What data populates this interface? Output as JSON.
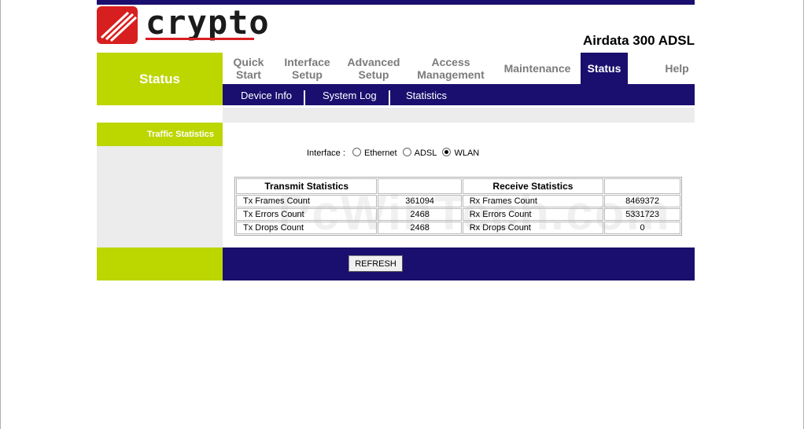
{
  "brand": {
    "logo_text": "crypto",
    "product": "Airdata 300 ADSL"
  },
  "section_title": "Status",
  "nav": [
    {
      "line1": "Quick",
      "line2": "Start"
    },
    {
      "line1": "Interface",
      "line2": "Setup"
    },
    {
      "line1": "Advanced",
      "line2": "Setup"
    },
    {
      "line1": "Access",
      "line2": "Management"
    },
    {
      "line1": "Maintenance",
      "line2": ""
    },
    {
      "line1": "Status",
      "line2": ""
    },
    {
      "line1": "Help",
      "line2": ""
    }
  ],
  "subnav": [
    "Device Info",
    "System Log",
    "Statistics"
  ],
  "sidebar": {
    "label": "Traffic Statistics"
  },
  "interface": {
    "label": "Interface :",
    "options": [
      "Ethernet",
      "ADSL",
      "WLAN"
    ],
    "selected": "WLAN"
  },
  "stats": {
    "tx_header": "Transmit Statistics",
    "rx_header": "Receive Statistics",
    "rows": [
      {
        "tx_label": "Tx Frames Count",
        "tx_value": "361094",
        "rx_label": "Rx Frames Count",
        "rx_value": "8469372"
      },
      {
        "tx_label": "Tx Errors Count",
        "tx_value": "2468",
        "rx_label": "Rx Errors Count",
        "rx_value": "5331723"
      },
      {
        "tx_label": "Tx Drops Count",
        "tx_value": "2468",
        "rx_label": "Rx Drops Count",
        "rx_value": "0"
      }
    ]
  },
  "refresh_label": "REFRESH",
  "watermark": "PcWinTech.com",
  "colors": {
    "navy": "#1a0f6e",
    "lime": "#bcd600",
    "red": "#d81f1f"
  }
}
